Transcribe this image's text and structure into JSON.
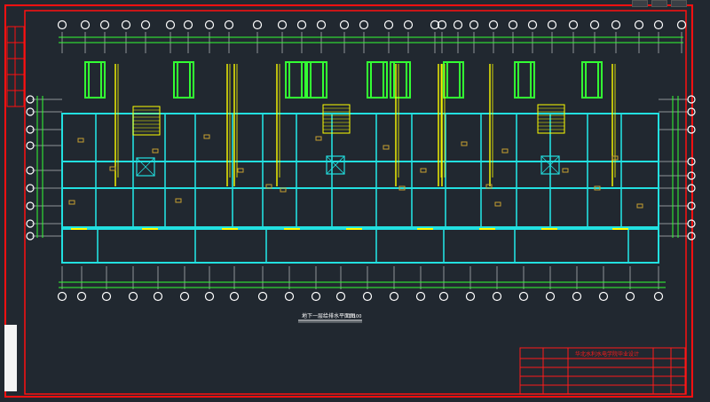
{
  "viewport": {
    "background": "#212830",
    "frame_color": "#ff1010"
  },
  "colors": {
    "wall": "#22e0e0",
    "grid": "#ffffff",
    "dim": "#33ff33",
    "pipe": "#ffff00",
    "furniture": "#c8a030",
    "title_block": "#ff1a1a"
  },
  "window_controls": [
    "minimize",
    "maximize",
    "close"
  ],
  "side_panel": {
    "color": "#f4f4f4"
  },
  "drawing": {
    "title": "地下一层给排水平面图",
    "scale": "1:100"
  },
  "title_block": {
    "project_name": "华北水利水电学院毕业设计",
    "rows": [
      "",
      "",
      "",
      "",
      ""
    ]
  }
}
